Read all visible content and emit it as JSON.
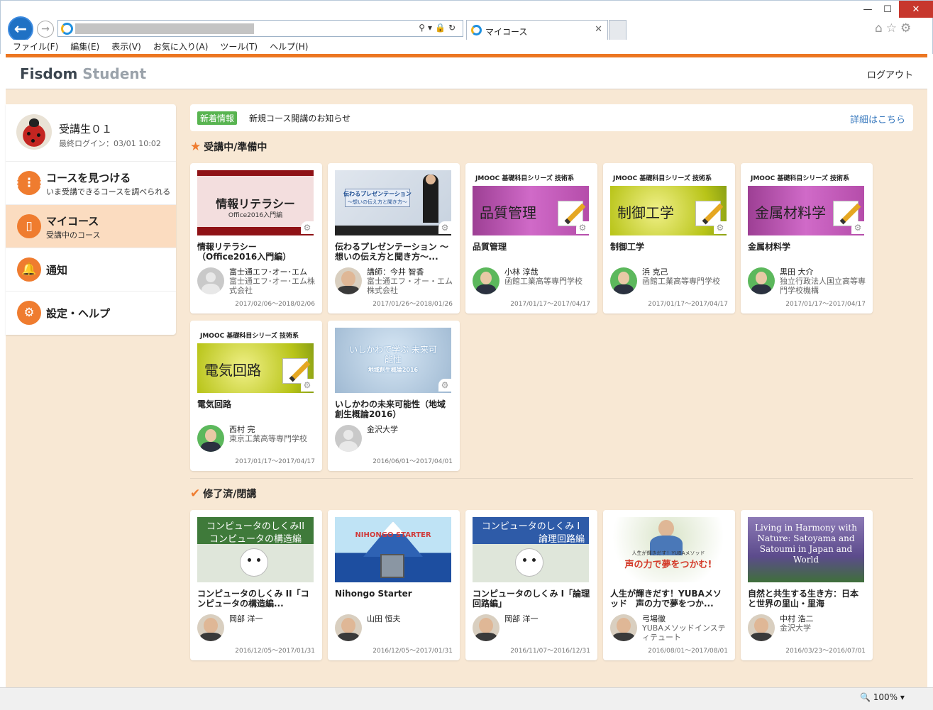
{
  "browser": {
    "tab_title": "マイコース",
    "menu": [
      "ファイル(F)",
      "編集(E)",
      "表示(V)",
      "お気に入り(A)",
      "ツール(T)",
      "ヘルプ(H)"
    ],
    "zoom": "100%"
  },
  "header": {
    "logo_main": "Fisdom",
    "logo_sub": "Student",
    "logout": "ログアウト"
  },
  "user": {
    "name": "受講生０１",
    "last_login": "最終ログイン：03/01 10:02"
  },
  "nav": [
    {
      "title": "コースを見つける",
      "sub": "いま受講できるコースを調べられる",
      "icon": "grid-icon"
    },
    {
      "title": "マイコース",
      "sub": "受講中のコース",
      "icon": "door-icon"
    },
    {
      "title": "通知",
      "sub": "",
      "icon": "bell-icon"
    },
    {
      "title": "設定・ヘルプ",
      "sub": "",
      "icon": "gear-icon"
    }
  ],
  "news": {
    "badge": "新着情報",
    "text": "新規コース開講のお知らせ",
    "link": "詳細はこちら"
  },
  "sections": {
    "active": "受講中/準備中",
    "done": "修了済/閉講"
  },
  "active_courses": [
    {
      "title": "情報リテラシー（Office2016入門編）",
      "thumb": "情報リテラシー",
      "thumb_sub": "Office2016入門編",
      "lecturer": "富士通エフ･オー･エム",
      "org": "富士通エフ･オー･エム株式会社",
      "date": "2017/02/06〜2018/02/06"
    },
    {
      "title": "伝わるプレゼンテーション 〜想いの伝え方と聞き方〜...",
      "thumb": "伝わるプレゼンテーション",
      "thumb_sub": "〜想いの伝え方と聞き方〜",
      "lecturer": "講師：今井 智香",
      "org": "富士通エフ・オー・エム株式会社",
      "date": "2017/01/26〜2018/01/26"
    },
    {
      "title": "品質管理",
      "thumb": "品質管理",
      "lecturer": "小林 淳哉",
      "org": "函館工業高等専門学校",
      "date": "2017/01/17〜2017/04/17"
    },
    {
      "title": "制御工学",
      "thumb": "制御工学",
      "lecturer": "浜 克己",
      "org": "函館工業高等専門学校",
      "date": "2017/01/17〜2017/04/17"
    },
    {
      "title": "金属材料学",
      "thumb": "金属材料学",
      "lecturer": "黒田 大介",
      "org": "独立行政法人国立高等専門学校機構",
      "date": "2017/01/17〜2017/04/17"
    },
    {
      "title": "電気回路",
      "thumb": "電気回路",
      "lecturer": "西村 完",
      "org": "東京工業高等専門学校",
      "date": "2017/01/17〜2017/04/17"
    },
    {
      "title": "いしかわの未来可能性（地域創生概論2016）",
      "thumb": "いしかわで学ぶ 未来可能性",
      "thumb_sub": "地域創生概論2016",
      "lecturer": "金沢大学",
      "org": "",
      "date": "2016/06/01〜2017/04/01"
    }
  ],
  "jmooc_header": "JMOOC 基礎科目シリーズ 技術系",
  "done_courses": [
    {
      "title": "コンピュータのしくみ II「コンピュータの構造編...",
      "thumb": "コンピュータのしくみII",
      "thumb_sub": "コンピュータの構造編",
      "lecturer": "岡部 洋一",
      "org": "",
      "date": "2016/12/05〜2017/01/31"
    },
    {
      "title": "Nihongo Starter",
      "thumb": "NIHONGO STARTER",
      "lecturer": "山田 恒夫",
      "org": "",
      "date": "2016/12/05〜2017/01/31"
    },
    {
      "title": "コンピュータのしくみ I「論理回路編」",
      "thumb": "コンピュータのしくみ I",
      "thumb_sub": "論理回路編",
      "lecturer": "岡部 洋一",
      "org": "",
      "date": "2016/11/07〜2016/12/31"
    },
    {
      "title": "人生が輝きだす！YUBAメソッド　声の力で夢をつか...",
      "thumb": "声の力で夢をつかむ!",
      "thumb_sub": "人生が輝きだす！YUBAメソッド",
      "lecturer": "弓場徹",
      "org": "YUBAメソッドインスティテュート",
      "date": "2016/08/01〜2017/08/01"
    },
    {
      "title": "自然と共生する生き方：日本と世界の里山・里海",
      "thumb": "Living in Harmony with Nature: Satoyama and Satoumi in Japan and World",
      "lecturer": "中村 浩二",
      "org": "金沢大学",
      "date": "2016/03/23〜2016/07/01"
    }
  ]
}
